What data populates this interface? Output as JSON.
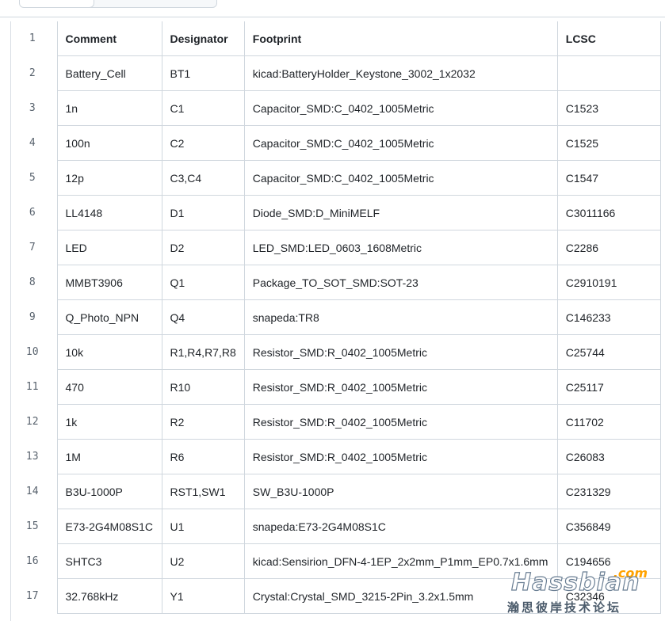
{
  "table": {
    "header": {
      "line": "1",
      "columns": [
        "Comment",
        "Designator",
        "Footprint",
        "LCSC"
      ]
    },
    "rows": [
      {
        "line": "2",
        "cells": [
          "Battery_Cell",
          "BT1",
          "kicad:BatteryHolder_Keystone_3002_1x2032",
          ""
        ]
      },
      {
        "line": "3",
        "cells": [
          "1n",
          "C1",
          "Capacitor_SMD:C_0402_1005Metric",
          "C1523"
        ]
      },
      {
        "line": "4",
        "cells": [
          "100n",
          "C2",
          "Capacitor_SMD:C_0402_1005Metric",
          "C1525"
        ]
      },
      {
        "line": "5",
        "cells": [
          "12p",
          "C3,C4",
          "Capacitor_SMD:C_0402_1005Metric",
          "C1547"
        ]
      },
      {
        "line": "6",
        "cells": [
          "LL4148",
          "D1",
          "Diode_SMD:D_MiniMELF",
          "C3011166"
        ]
      },
      {
        "line": "7",
        "cells": [
          "LED",
          "D2",
          "LED_SMD:LED_0603_1608Metric",
          "C2286"
        ]
      },
      {
        "line": "8",
        "cells": [
          "MMBT3906",
          "Q1",
          "Package_TO_SOT_SMD:SOT-23",
          "C2910191"
        ]
      },
      {
        "line": "9",
        "cells": [
          "Q_Photo_NPN",
          "Q4",
          "snapeda:TR8",
          "C146233"
        ]
      },
      {
        "line": "10",
        "cells": [
          "10k",
          "R1,R4,R7,R8",
          "Resistor_SMD:R_0402_1005Metric",
          "C25744"
        ]
      },
      {
        "line": "11",
        "cells": [
          "470",
          "R10",
          "Resistor_SMD:R_0402_1005Metric",
          "C25117"
        ]
      },
      {
        "line": "12",
        "cells": [
          "1k",
          "R2",
          "Resistor_SMD:R_0402_1005Metric",
          "C11702"
        ]
      },
      {
        "line": "13",
        "cells": [
          "1M",
          "R6",
          "Resistor_SMD:R_0402_1005Metric",
          "C26083"
        ]
      },
      {
        "line": "14",
        "cells": [
          "B3U-1000P",
          "RST1,SW1",
          "SW_B3U-1000P",
          "C231329"
        ]
      },
      {
        "line": "15",
        "cells": [
          "E73-2G4M08S1C",
          "U1",
          "snapeda:E73-2G4M08S1C",
          "C356849"
        ]
      },
      {
        "line": "16",
        "cells": [
          "SHTC3",
          "U2",
          "kicad:Sensirion_DFN-4-1EP_2x2mm_P1mm_EP0.7x1.6mm",
          "C194656"
        ]
      },
      {
        "line": "17",
        "cells": [
          "32.768kHz",
          "Y1",
          "Crystal:Crystal_SMD_3215-2Pin_3.2x1.5mm",
          "C32346"
        ]
      }
    ]
  },
  "watermark": {
    "brand": "Hassbian",
    "suffix": ".com",
    "subtitle": "瀚思彼岸技术论坛"
  }
}
